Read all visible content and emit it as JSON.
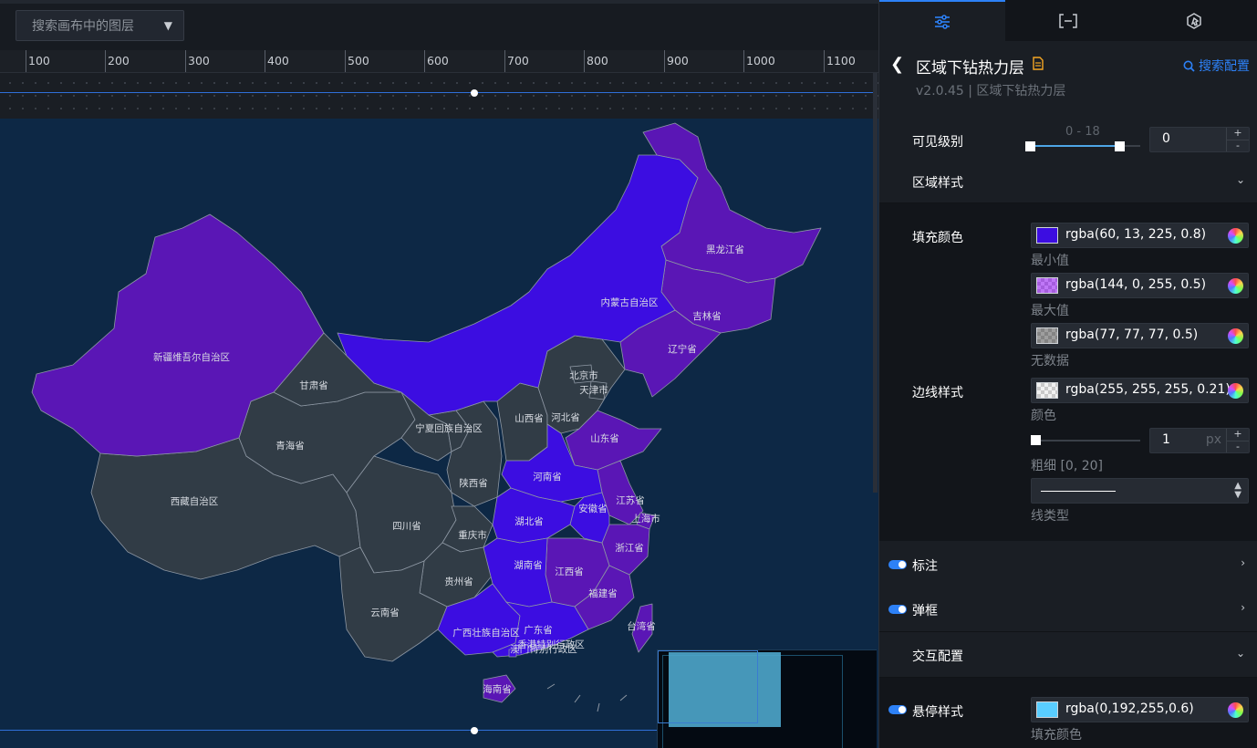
{
  "toolbar": {
    "layer_search_placeholder": "搜索画布中的图层"
  },
  "ruler": {
    "labels": [
      "100",
      "200",
      "300",
      "400",
      "500",
      "600",
      "700",
      "800",
      "900",
      "1000",
      "1100"
    ]
  },
  "map": {
    "regions": {
      "xinjiang": "新疆维吾尔自治区",
      "xizang": "西藏自治区",
      "qinghai": "青海省",
      "gansu": "甘肃省",
      "neimenggu": "内蒙古自治区",
      "heilongjiang": "黑龙江省",
      "jilin": "吉林省",
      "liaoning": "辽宁省",
      "beijing": "北京市",
      "tianjin": "天津市",
      "hebei": "河北省",
      "shanxi": "山西省",
      "ningxia": "宁夏回族自治区",
      "shaanxi": "陕西省",
      "shandong": "山东省",
      "henan": "河南省",
      "jiangsu": "江苏省",
      "anhui": "安徽省",
      "shanghai": "上海市",
      "sichuan": "四川省",
      "chongqing": "重庆市",
      "hubei": "湖北省",
      "zhejiang": "浙江省",
      "hunan": "湖南省",
      "jiangxi": "江西省",
      "guizhou": "贵州省",
      "fujian": "福建省",
      "yunnan": "云南省",
      "guangxi": "广西壮族自治区",
      "guangdong": "广东省",
      "taiwan": "台湾省",
      "xianggang": "香港特别行政区",
      "aomen": "澳门特别行政区",
      "hainan": "海南省"
    },
    "colors": {
      "min": "#3c0de1",
      "max": "#5a16b5",
      "nodata": "#313c46",
      "border": "#8d97a3",
      "bg": "#0d2845"
    }
  },
  "panel": {
    "tabs": [
      "settings-icon",
      "data-bracket-icon",
      "interaction-icon"
    ],
    "title": "区域下钻热力层",
    "version": "v2.0.45 | 区域下钻热力层",
    "search_config": "搜索配置",
    "visible_level": {
      "label": "可见级别",
      "range": "0 - 18",
      "value": "0"
    },
    "area_style": {
      "label": "区域样式",
      "fill_label": "填充颜色",
      "min_color": "rgba(60, 13, 225, 0.8)",
      "min_label": "最小值",
      "min_swatch": "#3c0de1",
      "max_color": "rgba(144, 0, 255, 0.5)",
      "max_label": "最大值",
      "max_swatch": "#b062ff",
      "nodata_color": "rgba(77, 77, 77, 0.5)",
      "nodata_label": "无数据",
      "nodata_swatch": "#9a9a9a",
      "border_label": "边线样式",
      "border_color": "rgba(255, 255, 255, 0.21)",
      "border_color_label": "颜色",
      "border_width": "1",
      "border_width_unit": "px",
      "border_width_label": "粗细 [0, 20]",
      "line_type_label": "线类型"
    },
    "annotation": {
      "label": "标注"
    },
    "popup": {
      "label": "弹框"
    },
    "interaction": {
      "label": "交互配置"
    },
    "hover": {
      "label": "悬停样式",
      "color": "rgba(0,192,255,0.6)",
      "swatch": "#59cdff",
      "sub_label": "填充颜色"
    }
  }
}
